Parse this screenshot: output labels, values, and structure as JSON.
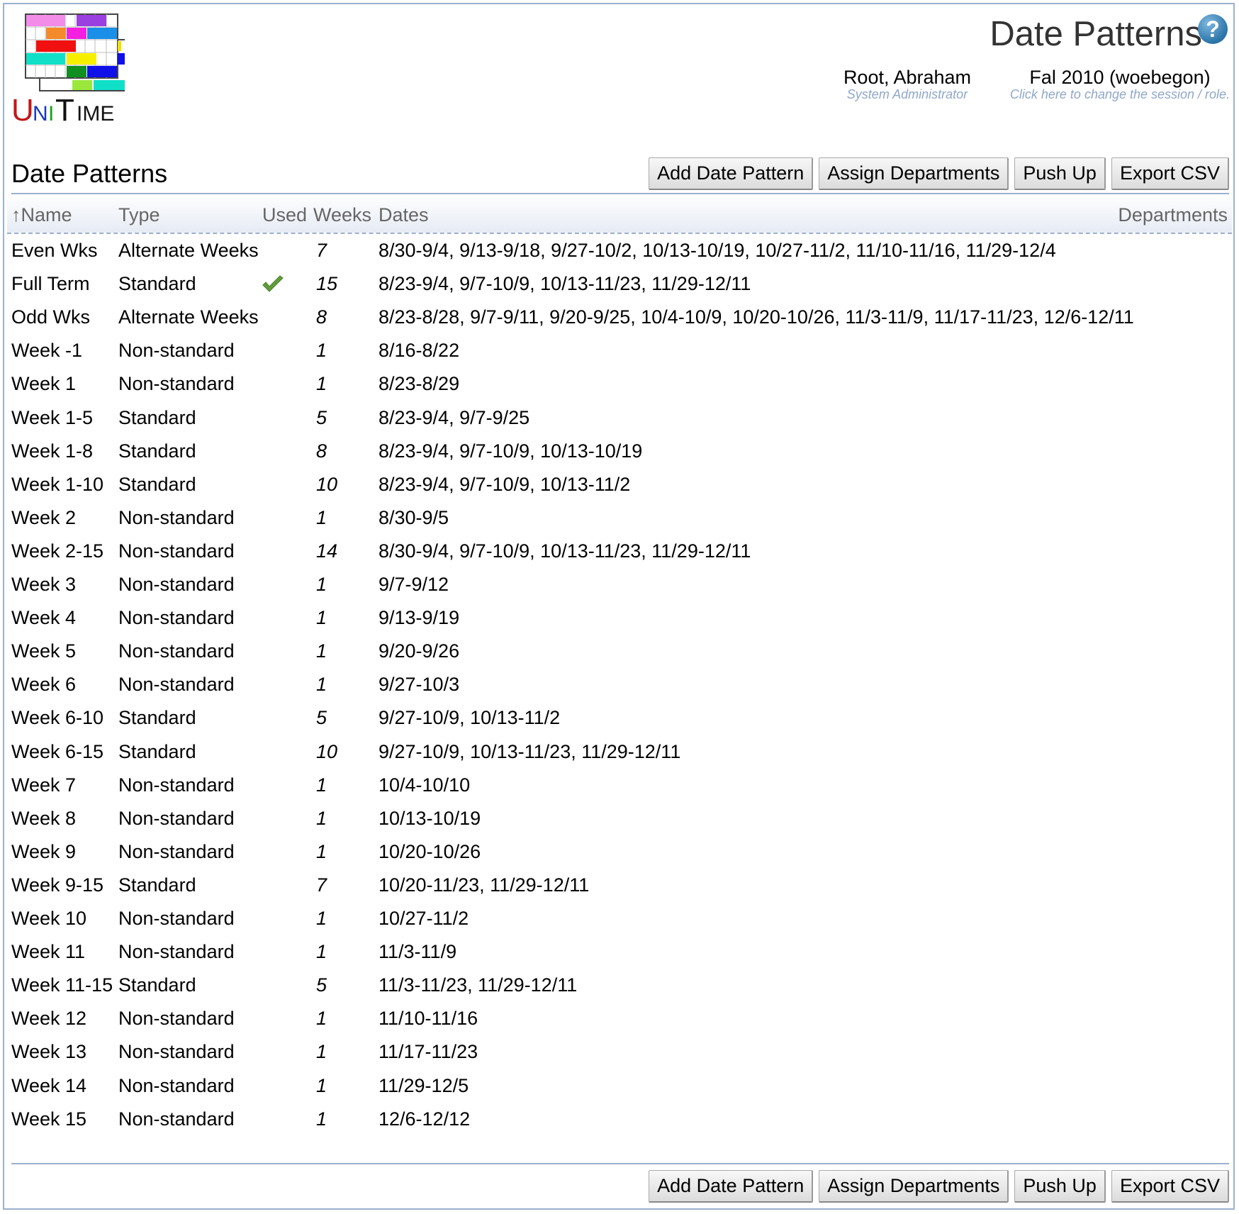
{
  "app": {
    "logo_text": "UniTime",
    "page_title": "Date Patterns",
    "help_icon": "help-icon"
  },
  "user": {
    "name": "Root, Abraham",
    "role": "System Administrator",
    "session": "Fal 2010 (woebegon)",
    "session_hint": "Click here to change the session / role."
  },
  "section": {
    "title": "Date Patterns"
  },
  "buttons": {
    "add": "Add Date Pattern",
    "assign": "Assign Departments",
    "push_up": "Push Up",
    "export": "Export CSV"
  },
  "table": {
    "sort_indicator": "↑",
    "headers": {
      "name": "Name",
      "type": "Type",
      "used": "Used",
      "weeks": "Weeks",
      "dates": "Dates",
      "departments": "Departments"
    },
    "rows": [
      {
        "name": "Even Wks",
        "type": "Alternate Weeks",
        "used": false,
        "weeks": "7",
        "dates": "8/30-9/4, 9/13-9/18, 9/27-10/2, 10/13-10/19, 10/27-11/2, 11/10-11/16, 11/29-12/4",
        "departments": ""
      },
      {
        "name": "Full Term",
        "type": "Standard",
        "used": true,
        "weeks": "15",
        "dates": "8/23-9/4, 9/7-10/9, 10/13-11/23, 11/29-12/11",
        "departments": ""
      },
      {
        "name": "Odd Wks",
        "type": "Alternate Weeks",
        "used": false,
        "weeks": "8",
        "dates": "8/23-8/28, 9/7-9/11, 9/20-9/25, 10/4-10/9, 10/20-10/26, 11/3-11/9, 11/17-11/23, 12/6-12/11",
        "departments": ""
      },
      {
        "name": "Week -1",
        "type": "Non-standard",
        "used": false,
        "weeks": "1",
        "dates": "8/16-8/22",
        "departments": ""
      },
      {
        "name": "Week 1",
        "type": "Non-standard",
        "used": false,
        "weeks": "1",
        "dates": "8/23-8/29",
        "departments": ""
      },
      {
        "name": "Week 1-5",
        "type": "Standard",
        "used": false,
        "weeks": "5",
        "dates": "8/23-9/4, 9/7-9/25",
        "departments": ""
      },
      {
        "name": "Week 1-8",
        "type": "Standard",
        "used": false,
        "weeks": "8",
        "dates": "8/23-9/4, 9/7-10/9, 10/13-10/19",
        "departments": ""
      },
      {
        "name": "Week 1-10",
        "type": "Standard",
        "used": false,
        "weeks": "10",
        "dates": "8/23-9/4, 9/7-10/9, 10/13-11/2",
        "departments": ""
      },
      {
        "name": "Week 2",
        "type": "Non-standard",
        "used": false,
        "weeks": "1",
        "dates": "8/30-9/5",
        "departments": ""
      },
      {
        "name": "Week 2-15",
        "type": "Non-standard",
        "used": false,
        "weeks": "14",
        "dates": "8/30-9/4, 9/7-10/9, 10/13-11/23, 11/29-12/11",
        "departments": ""
      },
      {
        "name": "Week 3",
        "type": "Non-standard",
        "used": false,
        "weeks": "1",
        "dates": "9/7-9/12",
        "departments": ""
      },
      {
        "name": "Week 4",
        "type": "Non-standard",
        "used": false,
        "weeks": "1",
        "dates": "9/13-9/19",
        "departments": ""
      },
      {
        "name": "Week 5",
        "type": "Non-standard",
        "used": false,
        "weeks": "1",
        "dates": "9/20-9/26",
        "departments": ""
      },
      {
        "name": "Week 6",
        "type": "Non-standard",
        "used": false,
        "weeks": "1",
        "dates": "9/27-10/3",
        "departments": ""
      },
      {
        "name": "Week 6-10",
        "type": "Standard",
        "used": false,
        "weeks": "5",
        "dates": "9/27-10/9, 10/13-11/2",
        "departments": ""
      },
      {
        "name": "Week 6-15",
        "type": "Standard",
        "used": false,
        "weeks": "10",
        "dates": "9/27-10/9, 10/13-11/23, 11/29-12/11",
        "departments": ""
      },
      {
        "name": "Week 7",
        "type": "Non-standard",
        "used": false,
        "weeks": "1",
        "dates": "10/4-10/10",
        "departments": ""
      },
      {
        "name": "Week 8",
        "type": "Non-standard",
        "used": false,
        "weeks": "1",
        "dates": "10/13-10/19",
        "departments": ""
      },
      {
        "name": "Week 9",
        "type": "Non-standard",
        "used": false,
        "weeks": "1",
        "dates": "10/20-10/26",
        "departments": ""
      },
      {
        "name": "Week 9-15",
        "type": "Standard",
        "used": false,
        "weeks": "7",
        "dates": "10/20-11/23, 11/29-12/11",
        "departments": ""
      },
      {
        "name": "Week 10",
        "type": "Non-standard",
        "used": false,
        "weeks": "1",
        "dates": "10/27-11/2",
        "departments": ""
      },
      {
        "name": "Week 11",
        "type": "Non-standard",
        "used": false,
        "weeks": "1",
        "dates": "11/3-11/9",
        "departments": ""
      },
      {
        "name": "Week 11-15",
        "type": "Standard",
        "used": false,
        "weeks": "5",
        "dates": "11/3-11/23, 11/29-12/11",
        "departments": ""
      },
      {
        "name": "Week 12",
        "type": "Non-standard",
        "used": false,
        "weeks": "1",
        "dates": "11/10-11/16",
        "departments": ""
      },
      {
        "name": "Week 13",
        "type": "Non-standard",
        "used": false,
        "weeks": "1",
        "dates": "11/17-11/23",
        "departments": ""
      },
      {
        "name": "Week 14",
        "type": "Non-standard",
        "used": false,
        "weeks": "1",
        "dates": "11/29-12/5",
        "departments": ""
      },
      {
        "name": "Week 15",
        "type": "Non-standard",
        "used": false,
        "weeks": "1",
        "dates": "12/6-12/12",
        "departments": ""
      }
    ]
  },
  "colors": {
    "border": "#9cb0ce",
    "header_text": "#666666",
    "hint_text": "#8fa7ca",
    "check_green": "#5f9e3a",
    "help_blue": "#2a74a8"
  }
}
